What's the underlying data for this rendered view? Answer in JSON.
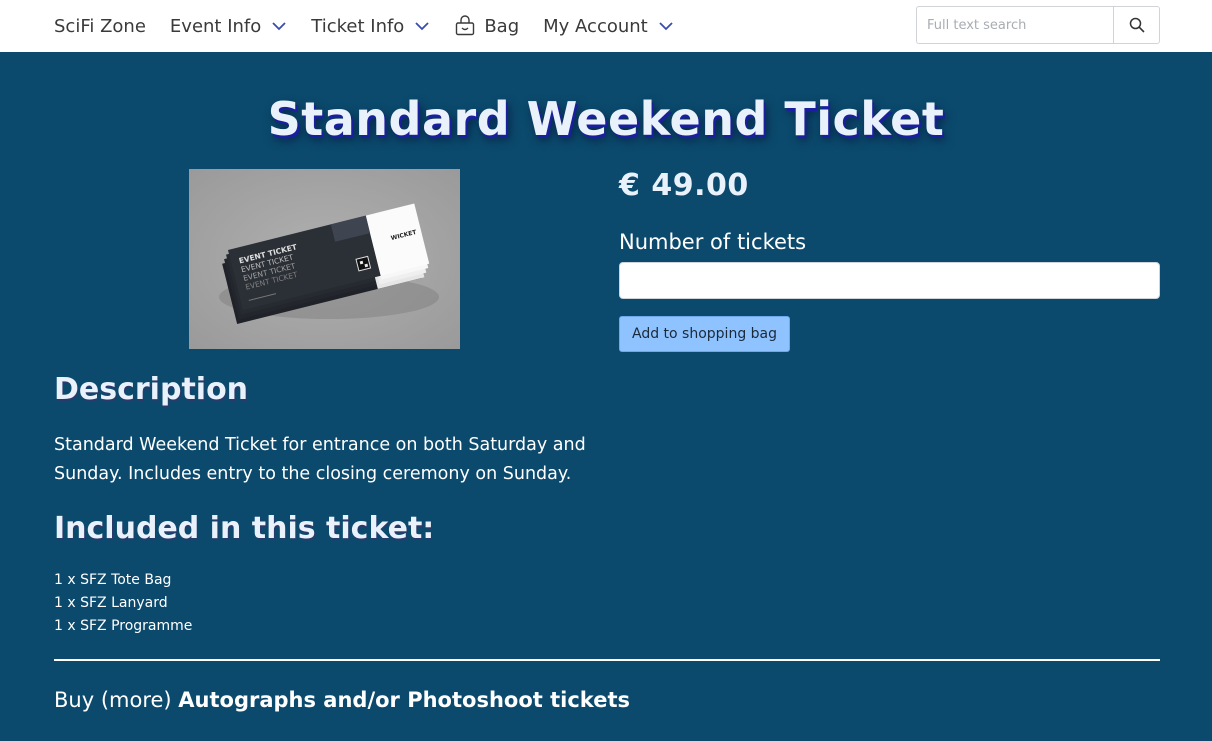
{
  "navbar": {
    "brand": "SciFi Zone",
    "items": [
      {
        "label": "Event Info",
        "has_dropdown": true
      },
      {
        "label": "Ticket Info",
        "has_dropdown": true
      },
      {
        "label": "Bag",
        "icon": "shopping-bag-icon"
      },
      {
        "label": "My Account",
        "has_dropdown": true
      }
    ],
    "search": {
      "placeholder": "Full text search",
      "icon": "search-icon"
    },
    "chevron_color": "#3a4bb0"
  },
  "product": {
    "title": "Standard Weekend Ticket",
    "price": "€ 49.00",
    "qty_label": "Number of tickets",
    "qty_value": "",
    "add_button": "Add to shopping bag",
    "image": {
      "ticket_lines": [
        "EVENT TICKET",
        "EVENT TICKET",
        "EVENT TICKET",
        "EVENT TICKET"
      ],
      "stub_text": "WICKET"
    }
  },
  "description": {
    "heading": "Description",
    "text": "Standard Weekend Ticket for entrance on both Saturday and Sunday. Includes entry to the closing ceremony on Sunday."
  },
  "included": {
    "heading": "Included in this ticket:",
    "items": [
      "1 x SFZ Tote Bag",
      "1 x SFZ Lanyard",
      "1 x SFZ Programme"
    ]
  },
  "buy_more": {
    "prefix": "Buy (more) ",
    "link": "Autographs and/or Photoshoot tickets"
  },
  "colors": {
    "background": "#0b4a6d",
    "button": "#8fc3ff",
    "title_shadow": "#1a1f9e"
  }
}
